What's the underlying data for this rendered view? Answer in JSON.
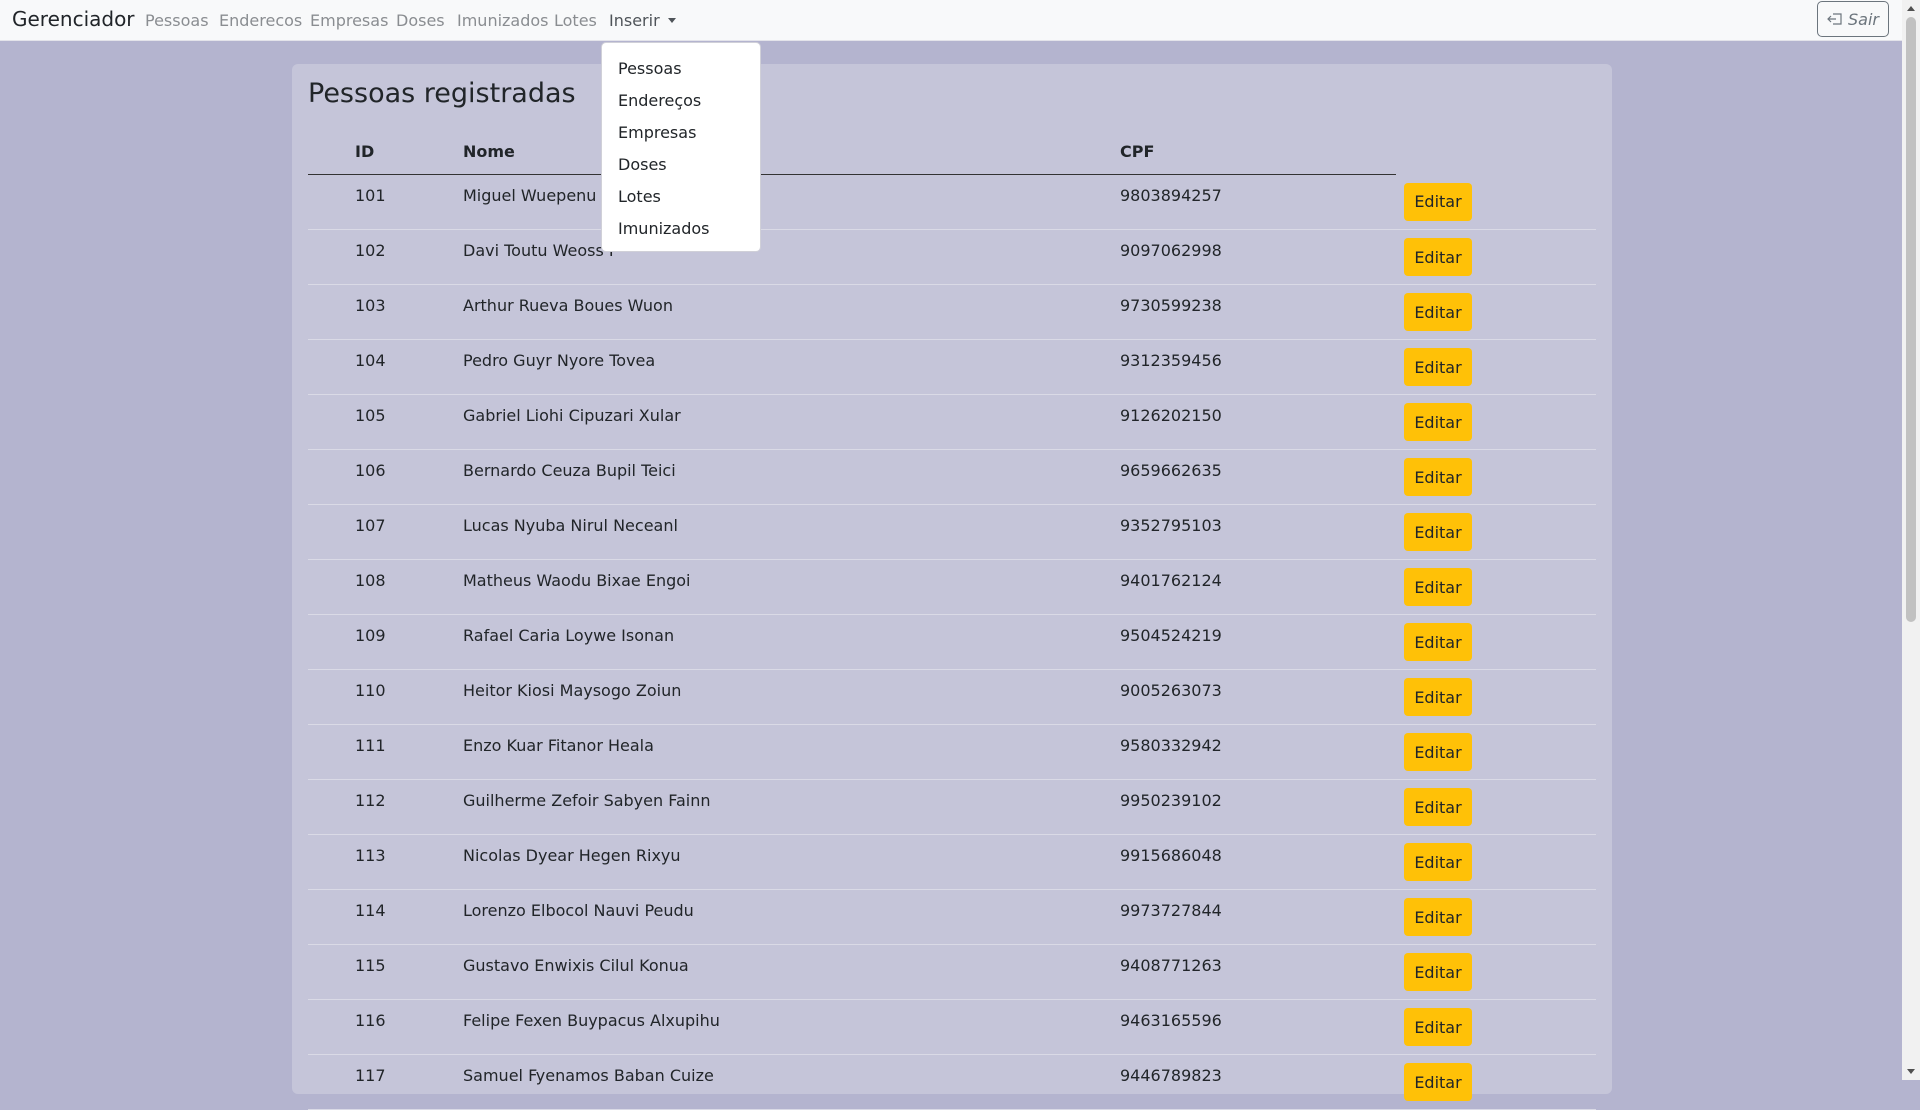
{
  "navbar": {
    "brand": "Gerenciador",
    "links": [
      "Pessoas",
      "Enderecos",
      "Empresas",
      "Doses",
      "Imunizados",
      "Lotes"
    ],
    "dropdown_label": "Inserir",
    "logout_label": "Sair",
    "logout_icon": "logout-icon"
  },
  "dropdown": {
    "items": [
      "Pessoas",
      "Endereços",
      "Empresas",
      "Doses",
      "Lotes",
      "Imunizados"
    ]
  },
  "main": {
    "title": "Pessoas registradas",
    "columns": [
      "ID",
      "Nome",
      "CPF"
    ],
    "edit_label": "Editar",
    "rows": [
      {
        "id": "101",
        "nome": "Miguel Wuepenu T",
        "cpf": "9803894257"
      },
      {
        "id": "102",
        "nome": "Davi Toutu Weoss I",
        "cpf": "9097062998"
      },
      {
        "id": "103",
        "nome": "Arthur Rueva Boues Wuon",
        "cpf": "9730599238"
      },
      {
        "id": "104",
        "nome": "Pedro Guyr Nyore Tovea",
        "cpf": "9312359456"
      },
      {
        "id": "105",
        "nome": "Gabriel Liohi Cipuzari Xular",
        "cpf": "9126202150"
      },
      {
        "id": "106",
        "nome": "Bernardo Ceuza Bupil Teici",
        "cpf": "9659662635"
      },
      {
        "id": "107",
        "nome": "Lucas Nyuba Nirul Neceanl",
        "cpf": "9352795103"
      },
      {
        "id": "108",
        "nome": "Matheus Waodu Bixae Engoi",
        "cpf": "9401762124"
      },
      {
        "id": "109",
        "nome": "Rafael Caria Loywe Isonan",
        "cpf": "9504524219"
      },
      {
        "id": "110",
        "nome": "Heitor Kiosi Maysogo Zoiun",
        "cpf": "9005263073"
      },
      {
        "id": "111",
        "nome": "Enzo Kuar Fitanor Heala",
        "cpf": "9580332942"
      },
      {
        "id": "112",
        "nome": "Guilherme Zefoir Sabyen Fainn",
        "cpf": "9950239102"
      },
      {
        "id": "113",
        "nome": "Nicolas Dyear Hegen Rixyu",
        "cpf": "9915686048"
      },
      {
        "id": "114",
        "nome": "Lorenzo Elbocol Nauvi Peudu",
        "cpf": "9973727844"
      },
      {
        "id": "115",
        "nome": "Gustavo Enwixis Cilul Konua",
        "cpf": "9408771263"
      },
      {
        "id": "116",
        "nome": "Felipe Fexen Buypacus Alxupihu",
        "cpf": "9463165596"
      },
      {
        "id": "117",
        "nome": "Samuel Fyenamos Baban Cuize",
        "cpf": "9446789823"
      }
    ]
  }
}
